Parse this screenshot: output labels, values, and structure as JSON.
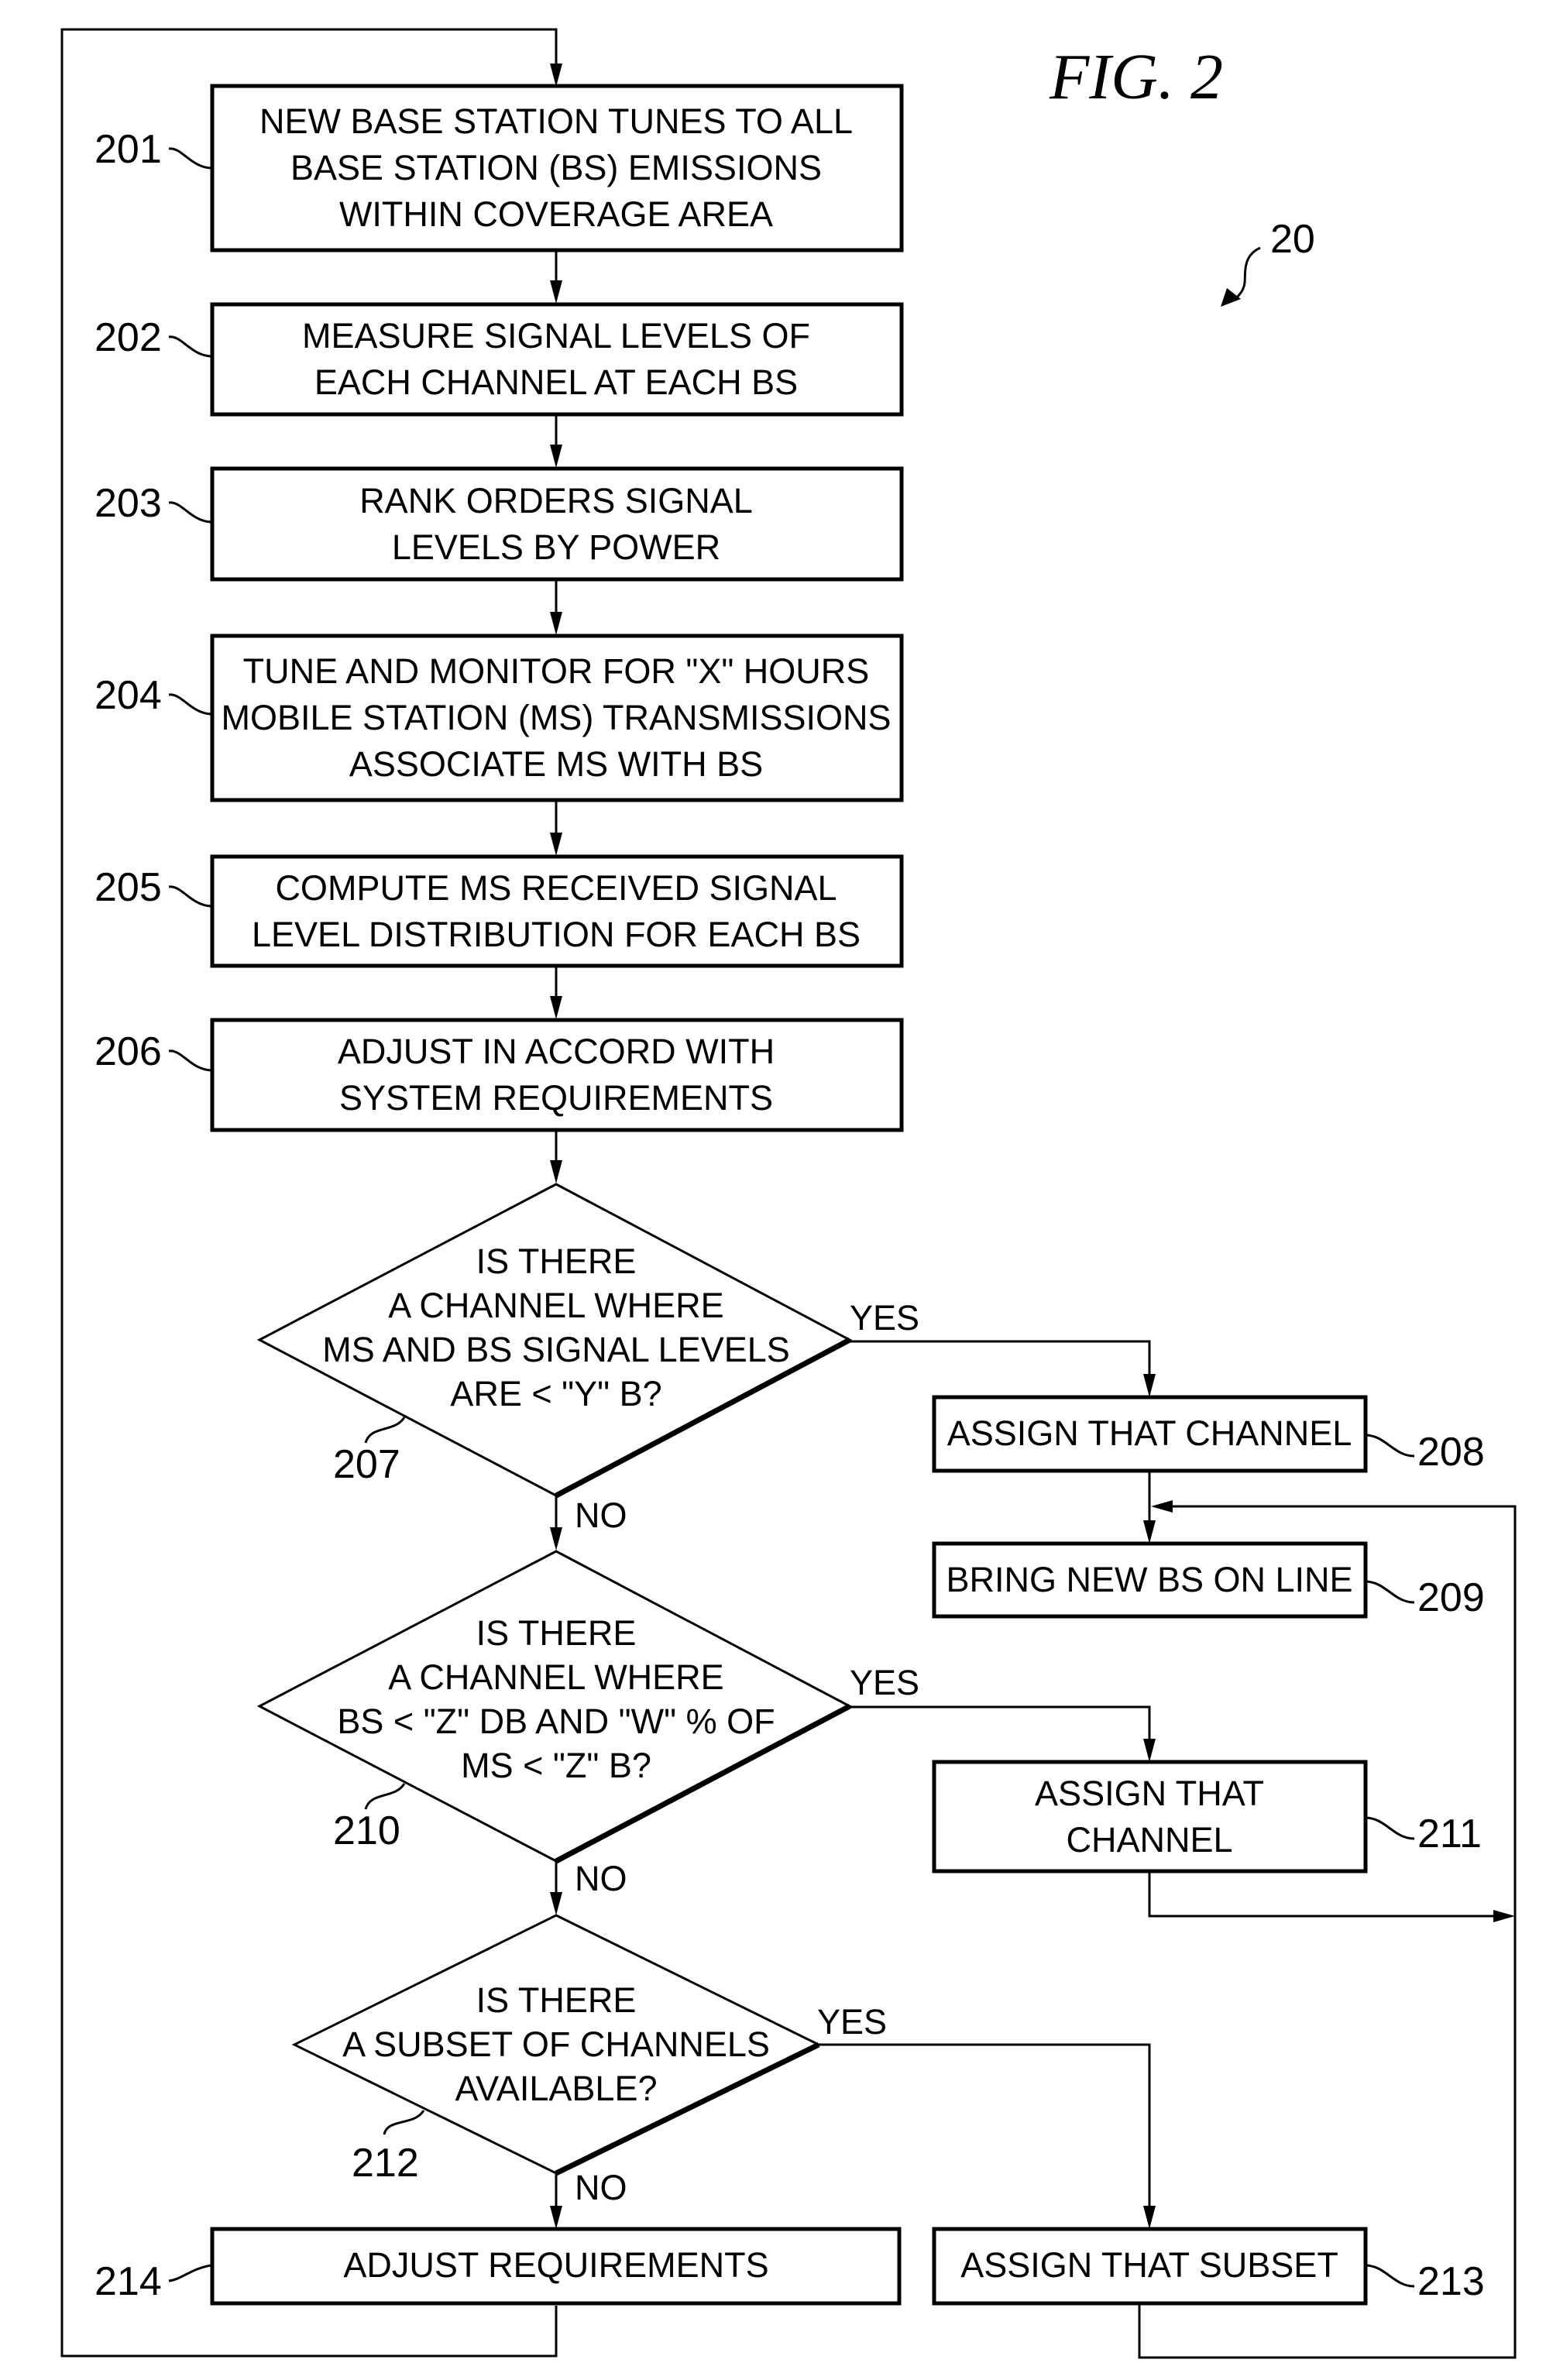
{
  "figure": {
    "title": "FIG. 2",
    "reference": "20"
  },
  "steps": [
    {
      "id": "201",
      "type": "process",
      "lines": [
        "NEW BASE STATION TUNES TO ALL",
        "BASE STATION (BS) EMISSIONS",
        "WITHIN COVERAGE AREA"
      ]
    },
    {
      "id": "202",
      "type": "process",
      "lines": [
        "MEASURE SIGNAL LEVELS OF",
        "EACH CHANNEL AT EACH BS"
      ]
    },
    {
      "id": "203",
      "type": "process",
      "lines": [
        "RANK ORDERS SIGNAL",
        "LEVELS BY POWER"
      ]
    },
    {
      "id": "204",
      "type": "process",
      "lines": [
        "TUNE AND MONITOR FOR \"X\" HOURS",
        "MOBILE STATION (MS) TRANSMISSIONS",
        "ASSOCIATE MS WITH BS"
      ]
    },
    {
      "id": "205",
      "type": "process",
      "lines": [
        "COMPUTE MS RECEIVED SIGNAL",
        "LEVEL DISTRIBUTION FOR EACH BS"
      ]
    },
    {
      "id": "206",
      "type": "process",
      "lines": [
        "ADJUST IN ACCORD WITH",
        "SYSTEM REQUIREMENTS"
      ]
    },
    {
      "id": "207",
      "type": "decision",
      "lines": [
        "IS THERE",
        "A CHANNEL WHERE",
        "MS AND BS SIGNAL LEVELS",
        "ARE < \"Y\" B?"
      ]
    },
    {
      "id": "208",
      "type": "process",
      "lines": [
        "ASSIGN THAT CHANNEL"
      ]
    },
    {
      "id": "209",
      "type": "process",
      "lines": [
        "BRING NEW BS ON LINE"
      ]
    },
    {
      "id": "210",
      "type": "decision",
      "lines": [
        "IS THERE",
        "A CHANNEL WHERE",
        "BS < \"Z\" DB AND \"W\" % OF",
        "MS < \"Z\" B?"
      ]
    },
    {
      "id": "211",
      "type": "process",
      "lines": [
        "ASSIGN THAT",
        "CHANNEL"
      ]
    },
    {
      "id": "212",
      "type": "decision",
      "lines": [
        "IS THERE",
        "A SUBSET OF CHANNELS",
        "AVAILABLE?"
      ]
    },
    {
      "id": "213",
      "type": "process",
      "lines": [
        "ASSIGN THAT SUBSET"
      ]
    },
    {
      "id": "214",
      "type": "process",
      "lines": [
        "ADJUST REQUIREMENTS"
      ]
    }
  ],
  "branch_labels": {
    "yes": "YES",
    "no": "NO"
  },
  "edges": [
    {
      "from": "201",
      "to": "202"
    },
    {
      "from": "202",
      "to": "203"
    },
    {
      "from": "203",
      "to": "204"
    },
    {
      "from": "204",
      "to": "205"
    },
    {
      "from": "205",
      "to": "206"
    },
    {
      "from": "206",
      "to": "207"
    },
    {
      "from": "207",
      "to": "208",
      "label": "YES"
    },
    {
      "from": "207",
      "to": "210",
      "label": "NO"
    },
    {
      "from": "208",
      "to": "209"
    },
    {
      "from": "210",
      "to": "211",
      "label": "YES"
    },
    {
      "from": "210",
      "to": "212",
      "label": "NO"
    },
    {
      "from": "211",
      "to": "209"
    },
    {
      "from": "212",
      "to": "213",
      "label": "YES"
    },
    {
      "from": "212",
      "to": "214",
      "label": "NO"
    },
    {
      "from": "213",
      "to": "209"
    },
    {
      "from": "214",
      "to": "201"
    }
  ]
}
